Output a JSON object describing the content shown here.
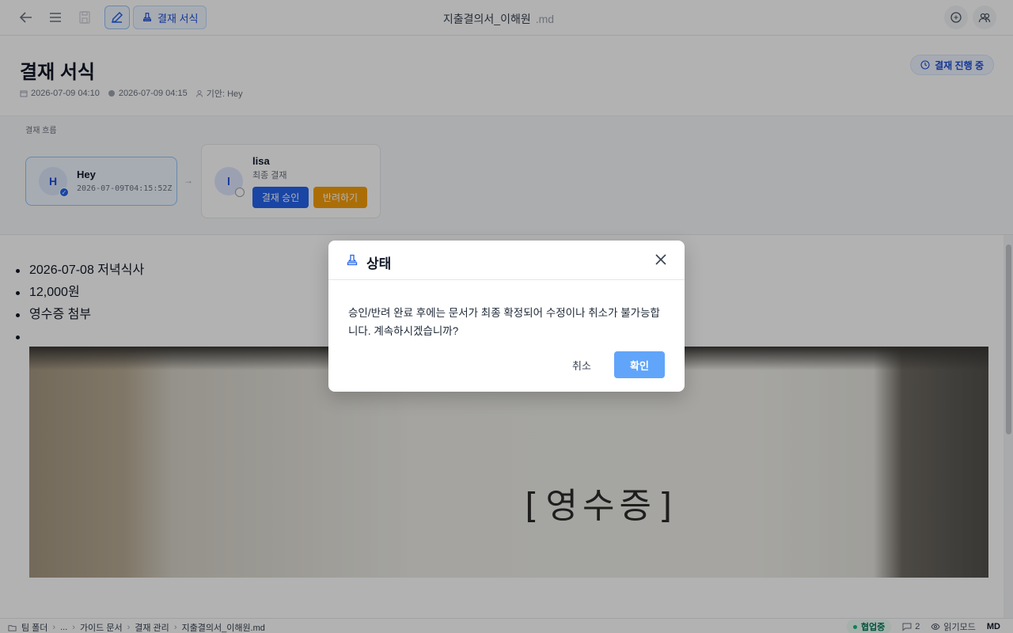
{
  "topbar": {
    "mode_label": "결재 서식",
    "doc_title": "지출결의서_이해원",
    "doc_ext": ".md"
  },
  "header": {
    "title": "결재 서식",
    "created": "2026-07-09 04:10",
    "updated": "2026-07-09 04:15",
    "drafter": "기안: Hey",
    "status": "결재 진행 중"
  },
  "flow": {
    "label": "결재 흐름",
    "steps": [
      {
        "initial": "H",
        "name": "Hey",
        "time": "2026-07-09T04:15:52Z"
      },
      {
        "initial": "l",
        "name": "lisa",
        "role": "최종 결재",
        "approve_label": "결재 승인",
        "reject_label": "반려하기"
      }
    ]
  },
  "content": {
    "items": [
      "2026-07-08 저녁식사",
      "12,000원",
      "영수증 첨부",
      ""
    ],
    "receipt_text": "[영수증]"
  },
  "bottombar": {
    "crumbs": [
      "팀 폴더",
      "...",
      "가이드 문서",
      "결재 관리",
      "지출결의서_이해원.md"
    ],
    "collab": "협업중",
    "comments": "2",
    "read_mode": "읽기모드",
    "format": "MD"
  },
  "dialog": {
    "title": "상태",
    "message": "승인/반려 완료 후에는 문서가 최종 확정되어 수정이나 취소가 불가능합니다. 계속하시겠습니까?",
    "cancel": "취소",
    "confirm": "확인"
  }
}
